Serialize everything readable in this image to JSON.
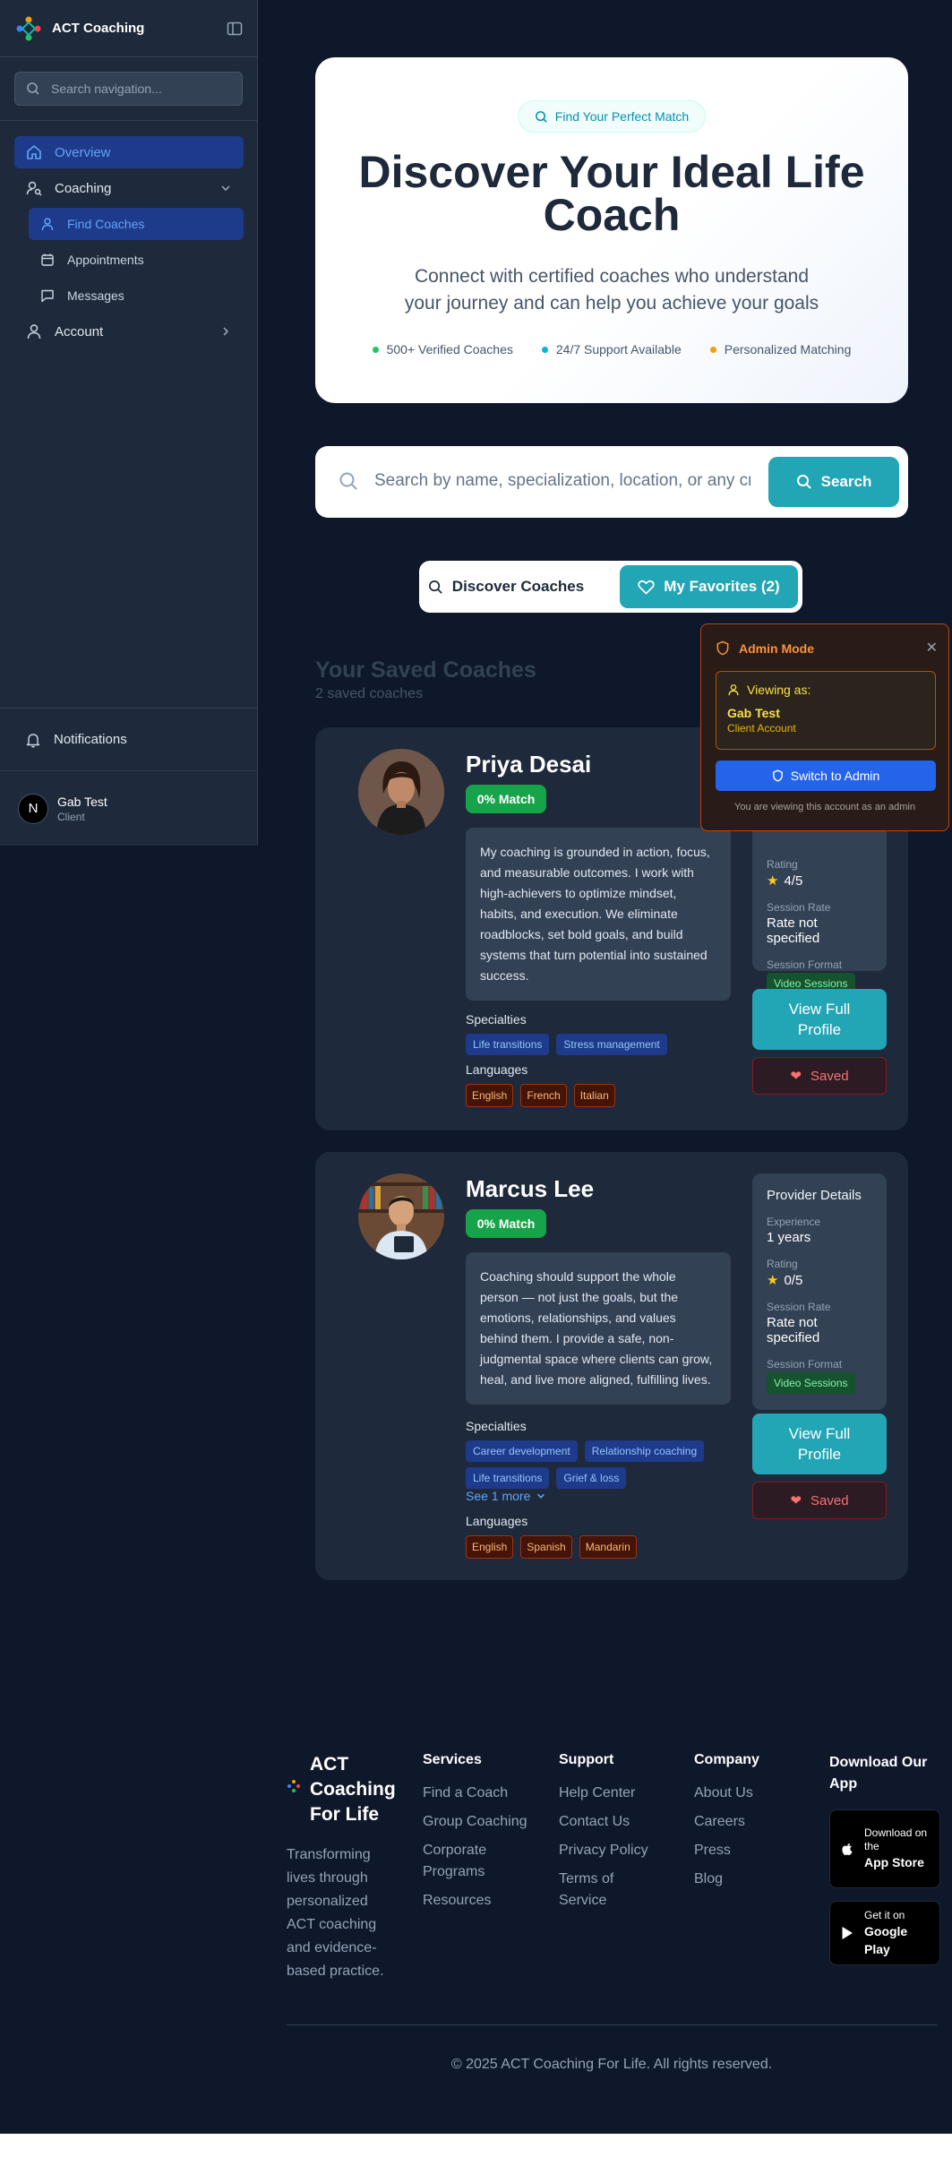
{
  "sidebar": {
    "brand": "ACT Coaching",
    "search_placeholder": "Search navigation...",
    "items": [
      {
        "label": "Overview"
      },
      {
        "label": "Coaching"
      },
      {
        "label": "Find Coaches"
      },
      {
        "label": "Appointments"
      },
      {
        "label": "Messages"
      },
      {
        "label": "Account"
      }
    ],
    "notifications": "Notifications",
    "user": {
      "initial": "N",
      "name": "Gab Test",
      "role": "Client"
    }
  },
  "hero": {
    "badge": "Find Your Perfect Match",
    "title": "Discover Your Ideal Life Coach",
    "subtitle": "Connect with certified coaches who understand your journey and can help you achieve your goals",
    "features": [
      {
        "label": "500+ Verified Coaches",
        "color": "#22c55e"
      },
      {
        "label": "24/7 Support Available",
        "color": "#06b6d4"
      },
      {
        "label": "Personalized Matching",
        "color": "#f59e0b"
      }
    ]
  },
  "search": {
    "placeholder": "Search by name, specialization, location, or any criteria...",
    "button": "Search"
  },
  "tabs": {
    "discover": "Discover Coaches",
    "favorites": "My Favorites (2)"
  },
  "saved": {
    "title": "Your Saved Coaches",
    "subtitle": "2 saved coaches"
  },
  "coaches": [
    {
      "name": "Priya Desai",
      "match": "0% Match",
      "bio": "My coaching is grounded in action, focus, and measurable outcomes. I work with high-achievers to optimize mindset, habits, and execution. We eliminate roadblocks, set bold goals, and build systems that turn potential into sustained success.",
      "specialties_label": "Specialties",
      "specialties": [
        "Life transitions",
        "Stress management"
      ],
      "languages_label": "Languages",
      "languages": [
        "English",
        "French",
        "Italian"
      ],
      "rating_label": "Rating",
      "rating": "4/5",
      "rate_label": "Session Rate",
      "rate": "Rate not specified",
      "format_label": "Session Format",
      "format": "Video Sessions",
      "view": "View Full Profile",
      "saved": "Saved"
    },
    {
      "name": "Marcus Lee",
      "match": "0% Match",
      "bio": "Coaching should support the whole person — not just the goals, but the emotions, relationships, and values behind them. I provide a safe, non-judgmental space where clients can grow, heal, and live more aligned, fulfilling lives.",
      "specialties_label": "Specialties",
      "specialties": [
        "Career development",
        "Relationship coaching",
        "Life transitions",
        "Grief & loss"
      ],
      "see_more": "See 1 more",
      "languages_label": "Languages",
      "languages": [
        "English",
        "Spanish",
        "Mandarin"
      ],
      "details_title": "Provider Details",
      "experience_label": "Experience",
      "experience": "1 years",
      "rating_label": "Rating",
      "rating": "0/5",
      "rate_label": "Session Rate",
      "rate": "Rate not specified",
      "format_label": "Session Format",
      "format": "Video Sessions",
      "view": "View Full Profile",
      "saved": "Saved"
    }
  ],
  "admin": {
    "title": "Admin Mode",
    "viewing_as": "Viewing as:",
    "name": "Gab Test",
    "account": "Client Account",
    "switch": "Switch to Admin",
    "note": "You are viewing this account as an admin"
  },
  "footer": {
    "brand": "ACT Coaching For Life",
    "description": "Transforming lives through personalized ACT coaching and evidence-based practice.",
    "services": {
      "title": "Services",
      "links": [
        "Find a Coach",
        "Group Coaching",
        "Corporate Programs",
        "Resources"
      ]
    },
    "support": {
      "title": "Support",
      "links": [
        "Help Center",
        "Contact Us",
        "Privacy Policy",
        "Terms of Service"
      ]
    },
    "company": {
      "title": "Company",
      "links": [
        "About Us",
        "Careers",
        "Press",
        "Blog"
      ]
    },
    "app": {
      "title": "Download Our App",
      "appstore_small": "Download on the",
      "appstore_big": "App Store",
      "google_small": "Get it on",
      "google_big": "Google Play"
    },
    "copyright": "© 2025 ACT Coaching For Life. All rights reserved."
  }
}
